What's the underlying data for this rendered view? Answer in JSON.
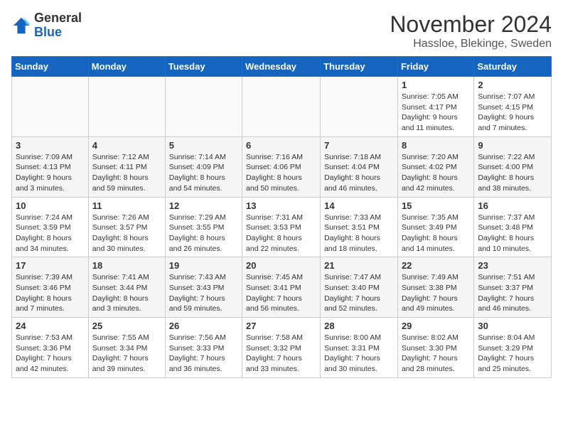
{
  "header": {
    "logo_general": "General",
    "logo_blue": "Blue",
    "month_title": "November 2024",
    "location": "Hassloe, Blekinge, Sweden"
  },
  "weekdays": [
    "Sunday",
    "Monday",
    "Tuesday",
    "Wednesday",
    "Thursday",
    "Friday",
    "Saturday"
  ],
  "weeks": [
    [
      {
        "day": "",
        "info": ""
      },
      {
        "day": "",
        "info": ""
      },
      {
        "day": "",
        "info": ""
      },
      {
        "day": "",
        "info": ""
      },
      {
        "day": "",
        "info": ""
      },
      {
        "day": "1",
        "info": "Sunrise: 7:05 AM\nSunset: 4:17 PM\nDaylight: 9 hours and 11 minutes."
      },
      {
        "day": "2",
        "info": "Sunrise: 7:07 AM\nSunset: 4:15 PM\nDaylight: 9 hours and 7 minutes."
      }
    ],
    [
      {
        "day": "3",
        "info": "Sunrise: 7:09 AM\nSunset: 4:13 PM\nDaylight: 9 hours and 3 minutes."
      },
      {
        "day": "4",
        "info": "Sunrise: 7:12 AM\nSunset: 4:11 PM\nDaylight: 8 hours and 59 minutes."
      },
      {
        "day": "5",
        "info": "Sunrise: 7:14 AM\nSunset: 4:09 PM\nDaylight: 8 hours and 54 minutes."
      },
      {
        "day": "6",
        "info": "Sunrise: 7:16 AM\nSunset: 4:06 PM\nDaylight: 8 hours and 50 minutes."
      },
      {
        "day": "7",
        "info": "Sunrise: 7:18 AM\nSunset: 4:04 PM\nDaylight: 8 hours and 46 minutes."
      },
      {
        "day": "8",
        "info": "Sunrise: 7:20 AM\nSunset: 4:02 PM\nDaylight: 8 hours and 42 minutes."
      },
      {
        "day": "9",
        "info": "Sunrise: 7:22 AM\nSunset: 4:00 PM\nDaylight: 8 hours and 38 minutes."
      }
    ],
    [
      {
        "day": "10",
        "info": "Sunrise: 7:24 AM\nSunset: 3:59 PM\nDaylight: 8 hours and 34 minutes."
      },
      {
        "day": "11",
        "info": "Sunrise: 7:26 AM\nSunset: 3:57 PM\nDaylight: 8 hours and 30 minutes."
      },
      {
        "day": "12",
        "info": "Sunrise: 7:29 AM\nSunset: 3:55 PM\nDaylight: 8 hours and 26 minutes."
      },
      {
        "day": "13",
        "info": "Sunrise: 7:31 AM\nSunset: 3:53 PM\nDaylight: 8 hours and 22 minutes."
      },
      {
        "day": "14",
        "info": "Sunrise: 7:33 AM\nSunset: 3:51 PM\nDaylight: 8 hours and 18 minutes."
      },
      {
        "day": "15",
        "info": "Sunrise: 7:35 AM\nSunset: 3:49 PM\nDaylight: 8 hours and 14 minutes."
      },
      {
        "day": "16",
        "info": "Sunrise: 7:37 AM\nSunset: 3:48 PM\nDaylight: 8 hours and 10 minutes."
      }
    ],
    [
      {
        "day": "17",
        "info": "Sunrise: 7:39 AM\nSunset: 3:46 PM\nDaylight: 8 hours and 7 minutes."
      },
      {
        "day": "18",
        "info": "Sunrise: 7:41 AM\nSunset: 3:44 PM\nDaylight: 8 hours and 3 minutes."
      },
      {
        "day": "19",
        "info": "Sunrise: 7:43 AM\nSunset: 3:43 PM\nDaylight: 7 hours and 59 minutes."
      },
      {
        "day": "20",
        "info": "Sunrise: 7:45 AM\nSunset: 3:41 PM\nDaylight: 7 hours and 56 minutes."
      },
      {
        "day": "21",
        "info": "Sunrise: 7:47 AM\nSunset: 3:40 PM\nDaylight: 7 hours and 52 minutes."
      },
      {
        "day": "22",
        "info": "Sunrise: 7:49 AM\nSunset: 3:38 PM\nDaylight: 7 hours and 49 minutes."
      },
      {
        "day": "23",
        "info": "Sunrise: 7:51 AM\nSunset: 3:37 PM\nDaylight: 7 hours and 46 minutes."
      }
    ],
    [
      {
        "day": "24",
        "info": "Sunrise: 7:53 AM\nSunset: 3:36 PM\nDaylight: 7 hours and 42 minutes."
      },
      {
        "day": "25",
        "info": "Sunrise: 7:55 AM\nSunset: 3:34 PM\nDaylight: 7 hours and 39 minutes."
      },
      {
        "day": "26",
        "info": "Sunrise: 7:56 AM\nSunset: 3:33 PM\nDaylight: 7 hours and 36 minutes."
      },
      {
        "day": "27",
        "info": "Sunrise: 7:58 AM\nSunset: 3:32 PM\nDaylight: 7 hours and 33 minutes."
      },
      {
        "day": "28",
        "info": "Sunrise: 8:00 AM\nSunset: 3:31 PM\nDaylight: 7 hours and 30 minutes."
      },
      {
        "day": "29",
        "info": "Sunrise: 8:02 AM\nSunset: 3:30 PM\nDaylight: 7 hours and 28 minutes."
      },
      {
        "day": "30",
        "info": "Sunrise: 8:04 AM\nSunset: 3:29 PM\nDaylight: 7 hours and 25 minutes."
      }
    ]
  ]
}
